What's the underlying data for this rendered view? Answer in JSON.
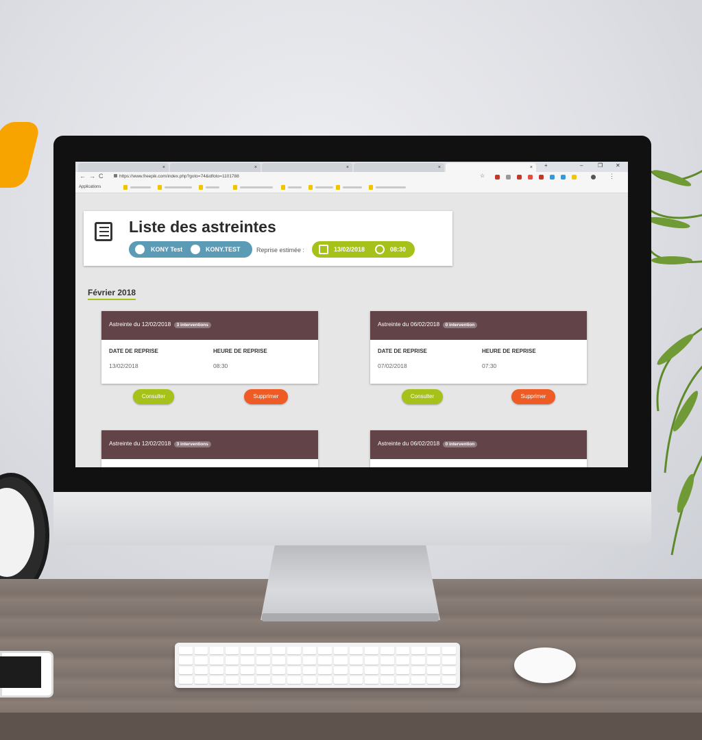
{
  "browser": {
    "url": "https://www.freepik.com/index.php?goto=74&idfoto=1101788",
    "bookmarks_label": "Applications",
    "window_controls": [
      "–",
      "❐",
      "✕"
    ],
    "new_tab": "+"
  },
  "page": {
    "title": "Liste des astreintes",
    "user": {
      "name": "KONY Test",
      "login": "KONY.TEST"
    },
    "reprise_label": "Reprise estimée :",
    "reprise_date": "13/02/2018",
    "reprise_time": "08:30",
    "month_heading": "Février 2018",
    "column_labels": {
      "date": "DATE DE REPRISE",
      "time": "HEURE DE REPRISE"
    },
    "buttons": {
      "consult": "Consulter",
      "delete": "Supprimer"
    },
    "cards": [
      {
        "title": "Astreinte du 12/02/2018",
        "badge": "3 interventions",
        "date": "13/02/2018",
        "time": "08:30"
      },
      {
        "title": "Astreinte du 06/02/2018",
        "badge": "0 intervention",
        "date": "07/02/2018",
        "time": "07:30"
      },
      {
        "title": "Astreinte du 12/02/2018",
        "badge": "3 interventions"
      },
      {
        "title": "Astreinte du 06/02/2018",
        "badge": "0 intervention"
      }
    ]
  },
  "colors": {
    "accent_green": "#a6c21a",
    "accent_blue": "#5b9bb5",
    "card_header": "#614348",
    "danger_orange": "#ef5b25"
  }
}
